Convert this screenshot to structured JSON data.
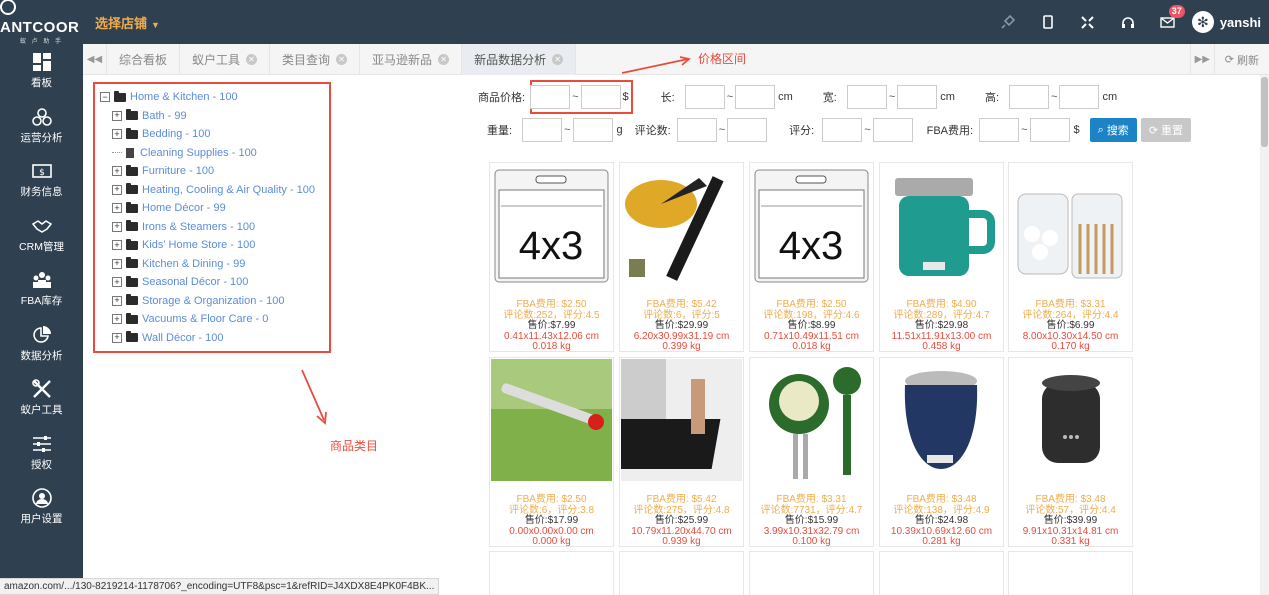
{
  "header": {
    "brand": "ANTCOOR",
    "brand_sub": "蚁 卢 助 手",
    "store_selector": "选择店铺",
    "mail_badge": "37",
    "username": "yanshi"
  },
  "sidebar": {
    "items": [
      {
        "label": "看板",
        "icon": "dashboard-icon"
      },
      {
        "label": "运营分析",
        "icon": "operations-icon"
      },
      {
        "label": "财务信息",
        "icon": "finance-icon"
      },
      {
        "label": "CRM管理",
        "icon": "handshake-icon"
      },
      {
        "label": "FBA库存",
        "icon": "inventory-icon"
      },
      {
        "label": "数据分析",
        "icon": "pie-chart-icon"
      },
      {
        "label": "蚁户工具",
        "icon": "tools-icon"
      },
      {
        "label": "授权",
        "icon": "sliders-icon"
      },
      {
        "label": "用户设置",
        "icon": "user-icon"
      }
    ]
  },
  "tabs": {
    "items": [
      "综合看板",
      "蚁户工具",
      "类目查询",
      "亚马逊新品",
      "新品数据分析"
    ],
    "active": 4,
    "refresh": "刷新"
  },
  "tree": {
    "root": "Home & Kitchen - 100",
    "children": [
      {
        "label": "Bath - 99",
        "type": "folder"
      },
      {
        "label": "Bedding - 100",
        "type": "folder"
      },
      {
        "label": "Cleaning Supplies - 100",
        "type": "file"
      },
      {
        "label": "Furniture - 100",
        "type": "folder"
      },
      {
        "label": "Heating, Cooling & Air Quality - 100",
        "type": "folder"
      },
      {
        "label": "Home Décor - 99",
        "type": "folder"
      },
      {
        "label": "Irons & Steamers - 100",
        "type": "folder"
      },
      {
        "label": "Kids' Home Store - 100",
        "type": "folder"
      },
      {
        "label": "Kitchen & Dining - 99",
        "type": "folder"
      },
      {
        "label": "Seasonal Décor - 100",
        "type": "folder"
      },
      {
        "label": "Storage & Organization - 100",
        "type": "folder"
      },
      {
        "label": "Vacuums & Floor Care - 0",
        "type": "folder"
      },
      {
        "label": "Wall Décor - 100",
        "type": "folder"
      }
    ]
  },
  "annotations": {
    "price_range": "价格区间",
    "category": "商品类目"
  },
  "filters": {
    "price": "商品价格:",
    "price_unit": "$",
    "length": "长:",
    "width": "宽:",
    "height": "高:",
    "cm": "cm",
    "weight": "重量:",
    "g": "g",
    "reviews": "评论数:",
    "rating": "评分:",
    "fba": "FBA费用:",
    "fba_unit": "$",
    "tilde": "~",
    "search": "搜索",
    "reset": "重置"
  },
  "products": [
    {
      "fba": "FBA费用: $2.50",
      "rev": "评论数:252，评分:4.5",
      "price": "售价:$7.99",
      "dim": "0.41x11.43x12.06 cm",
      "wt": "0.018 kg",
      "img": "card-holder"
    },
    {
      "fba": "FBA费用: $5.42",
      "rev": "评论数:6，评分:5",
      "price": "售价:$29.99",
      "dim": "6.20x30.99x31.19 cm",
      "wt": "0.399 kg",
      "img": "trap-bucket"
    },
    {
      "fba": "FBA费用: $2.50",
      "rev": "评论数:198，评分:4.6",
      "price": "售价:$8.99",
      "dim": "0.71x10.49x11.51 cm",
      "wt": "0.018 kg",
      "img": "card-holder"
    },
    {
      "fba": "FBA费用: $4.90",
      "rev": "评论数:289，评分:4.7",
      "price": "售价:$29.98",
      "dim": "11.51x11.91x13.00 cm",
      "wt": "0.458 kg",
      "img": "mug-teal"
    },
    {
      "fba": "FBA费用: $3.31",
      "rev": "评论数:264，评分:4.4",
      "price": "售价:$6.99",
      "dim": "8.00x10.30x14.50 cm",
      "wt": "0.170 kg",
      "img": "cotton-jars"
    },
    {
      "fba": "FBA费用: $2.50",
      "rev": "评论数:6，评分:3.8",
      "price": "售价:$17.99",
      "dim": "0.00x0.00x0.00 cm",
      "wt": "0.000 kg",
      "img": "garden-tube"
    },
    {
      "fba": "FBA费用: $5.42",
      "rev": "评论数:275，评分:4.8",
      "price": "售价:$25.99",
      "dim": "10.79x11.20x44.70 cm",
      "wt": "0.939 kg",
      "img": "kitchen-mat"
    },
    {
      "fba": "FBA费用: $3.31",
      "rev": "评论数:7731，评分:4.7",
      "price": "售价:$15.99",
      "dim": "3.99x10.31x32.79 cm",
      "wt": "0.100 kg",
      "img": "soil-meter"
    },
    {
      "fba": "FBA费用: $3.48",
      "rev": "评论数:138，评分:4.9",
      "price": "售价:$24.98",
      "dim": "10.39x10.69x12.60 cm",
      "wt": "0.281 kg",
      "img": "wine-tumbler"
    },
    {
      "fba": "FBA费用: $3.48",
      "rev": "评论数:57，评分:4.4",
      "price": "售价:$39.99",
      "dim": "9.91x10.31x14.81 cm",
      "wt": "0.331 kg",
      "img": "repeller"
    }
  ],
  "status_url": "amazon.com/.../130-8219214-1178706?_encoding=UTF8&psc=1&refRID=J4XDX8E4PK0F4BK..."
}
